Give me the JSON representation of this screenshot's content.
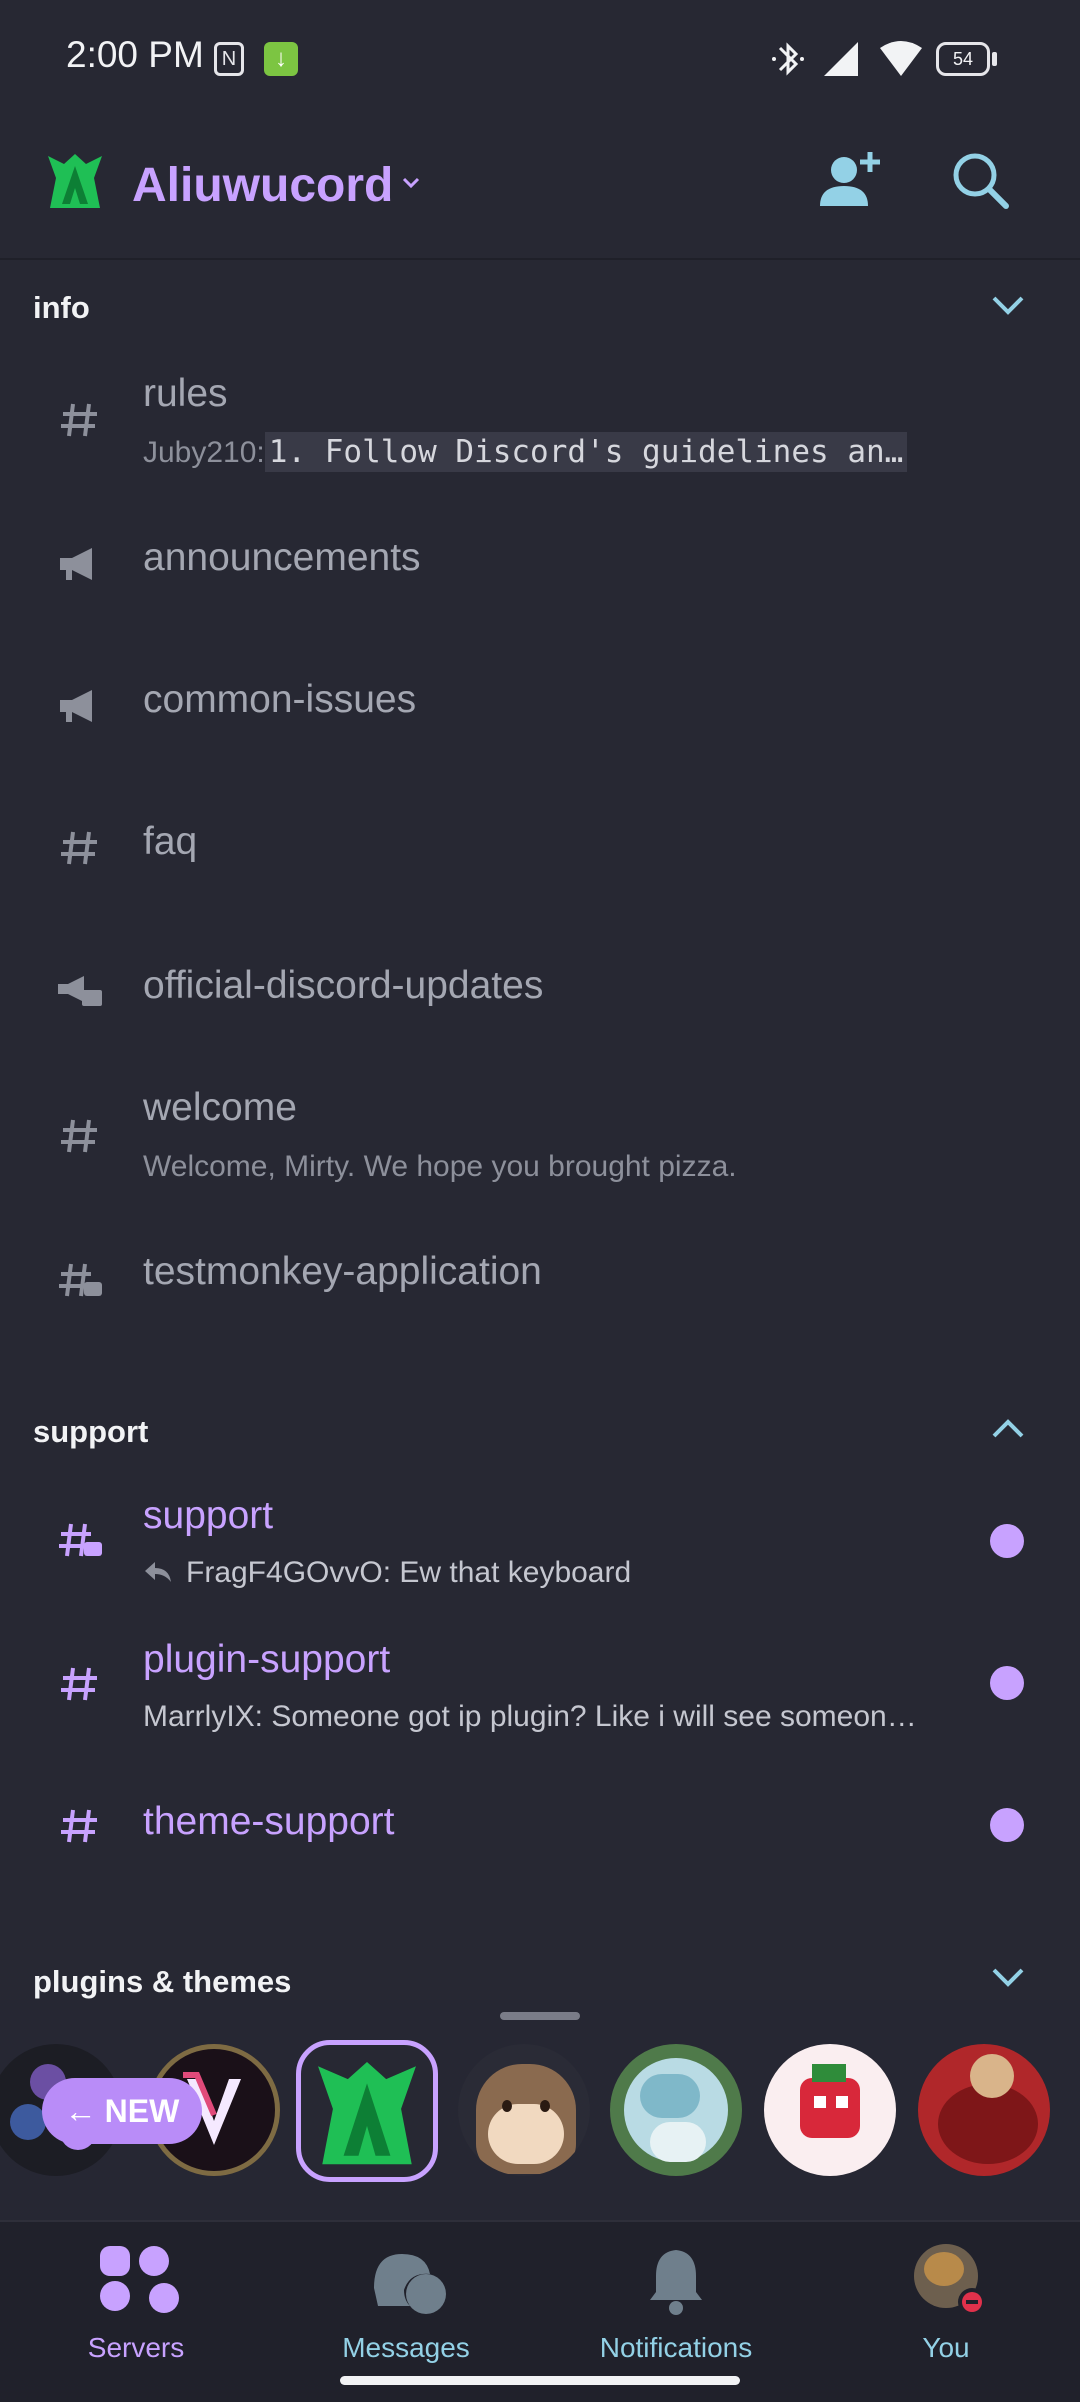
{
  "status_bar": {
    "time": "2:00 PM",
    "battery": "54"
  },
  "header": {
    "server_name": "Aliuwucord"
  },
  "categories": [
    {
      "name": "info"
    },
    {
      "name": "support"
    },
    {
      "name": "plugins & themes"
    }
  ],
  "channels": [
    {
      "name": "rules",
      "preview_author": "Juby210:",
      "preview_text": "1. Follow Discord's guidelines an…"
    },
    {
      "name": "announcements"
    },
    {
      "name": "common-issues"
    },
    {
      "name": "faq"
    },
    {
      "name": "official-discord-updates"
    },
    {
      "name": "welcome",
      "preview_text": "Welcome, Mirty. We hope you brought pizza."
    },
    {
      "name": "testmonkey-application"
    },
    {
      "name": "support",
      "preview_text": "FragF4GOvvO: Ew that keyboard",
      "unread": true
    },
    {
      "name": "plugin-support",
      "preview_text": "MarrlyIX: Someone got ip plugin? Like i will see someon…",
      "unread": true
    },
    {
      "name": "theme-support",
      "unread": true
    }
  ],
  "server_strip": {
    "new_label": "NEW"
  },
  "nav": [
    {
      "label": "Servers",
      "icon": "servers-icon",
      "active": true
    },
    {
      "label": "Messages",
      "icon": "messages-icon"
    },
    {
      "label": "Notifications",
      "icon": "bell-icon"
    },
    {
      "label": "You",
      "icon": "avatar"
    }
  ],
  "colors": {
    "accent": "#c8a2ff",
    "background": "#272833",
    "icon_blue": "#93d1e6"
  }
}
